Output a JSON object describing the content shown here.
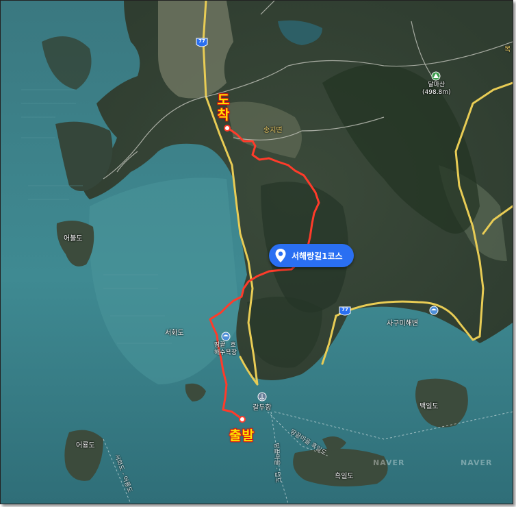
{
  "route": {
    "name": "서해랑길1코스",
    "start_label": "출발",
    "end_label": "도착",
    "route_color": "#ff3b2a",
    "badge_color": "#2a6ff2"
  },
  "roads": {
    "route_number": "77"
  },
  "places": {
    "peak_name": "달마산",
    "peak_elevation": "(498.8m)",
    "town": "송지면",
    "beach_1_line1": "땅끝",
    "beach_1_line2": "해수욕장",
    "beach_1_extra": "호",
    "beach_2": "사구미해변",
    "port": "갈두항",
    "island_1": "어불도",
    "island_2": "서화도",
    "island_3": "백일도",
    "island_4": "어룡도",
    "island_5": "흑일도",
    "ferry_1": "땅끝마을 흑일도",
    "ferry_2": "땅끝마을 - 넙도",
    "ferry_3": "서화도 - 어룡도",
    "edge_label": "목"
  },
  "watermark": {
    "left": "NAVER",
    "right": "NAVER"
  },
  "icons": {
    "location": "location-pin-icon",
    "mountain": "mountain-peak-icon",
    "beach": "beach-umbrella-icon",
    "port": "anchor-icon"
  }
}
